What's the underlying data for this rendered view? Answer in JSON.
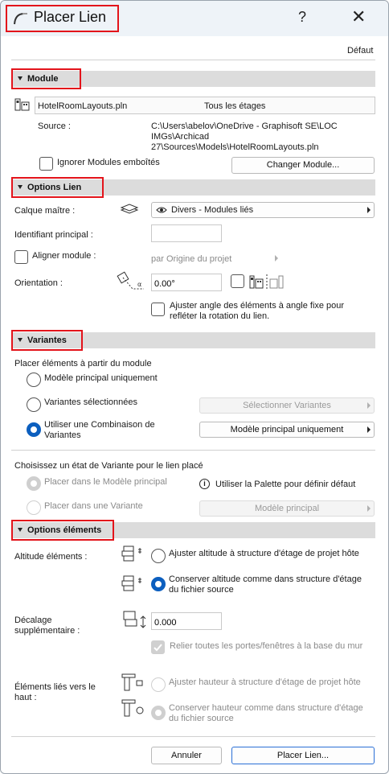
{
  "window": {
    "title": "Placer Lien",
    "help": "?",
    "close": "✕",
    "default_label": "Défaut"
  },
  "module": {
    "header": "Module",
    "file_name": "HotelRoomLayouts.pln",
    "floors": "Tous les étages",
    "source_label": "Source :",
    "source_line1": "C:\\Users\\abelov\\OneDrive - Graphisoft SE\\LOC",
    "source_line2": "IMGs\\Archicad",
    "source_line3": "27\\Sources\\Models\\HotelRoomLayouts.pln",
    "ignore_nested": "Ignorer Modules emboîtés",
    "change_button": "Changer Module..."
  },
  "link_options": {
    "header": "Options Lien",
    "master_layer_label": "Calque maître :",
    "master_layer_value": "Divers - Modules liés",
    "main_id_label": "Identifiant principal :",
    "main_id_value": "",
    "align_module_label": "Aligner module :",
    "align_module_value": "par Origine du projet",
    "orientation_label": "Orientation :",
    "orientation_value": "0.00°",
    "adjust_angle_line1": "Ajuster angle des éléments à angle fixe pour",
    "adjust_angle_line2": "refléter la rotation du lien."
  },
  "variants": {
    "header": "Variantes",
    "place_from_label": "Placer éléments à partir du module",
    "opt_main_only": "Modèle principal uniquement",
    "opt_selected": "Variantes sélectionnées",
    "select_variants_button": "Sélectionner Variantes",
    "opt_combination_line1": "Utiliser une Combinaison de",
    "opt_combination_line2": "Variantes",
    "combination_value": "Modèle principal uniquement",
    "state_label": "Choisissez un état de Variante pour le lien placé",
    "opt_place_main": "Placer dans le Modèle principal",
    "palette_info": "Utiliser la Palette pour définir défaut",
    "opt_place_variant": "Placer dans une Variante",
    "variant_value": "Modèle principal"
  },
  "element_options": {
    "header": "Options éléments",
    "elevation_label": "Altitude éléments :",
    "opt_adjust_elev": "Ajuster altitude à structure d'étage de projet hôte",
    "opt_keep_elev_line1": "Conserver altitude comme dans structure d'étage",
    "opt_keep_elev_line2": "du fichier source",
    "offset_label_line1": "Décalage",
    "offset_label_line2": "supplémentaire :",
    "offset_value": "0.000",
    "connect_doors": "Relier toutes les portes/fenêtres à la base du mur",
    "top_linked_label_line1": "Éléments liés vers le",
    "top_linked_label_line2": "haut :",
    "opt_adjust_height": "Ajuster hauteur à structure d'étage de projet hôte",
    "opt_keep_height_line1": "Conserver hauteur comme dans structure d'étage",
    "opt_keep_height_line2": "du fichier source"
  },
  "footer": {
    "cancel": "Annuler",
    "place": "Placer Lien..."
  }
}
